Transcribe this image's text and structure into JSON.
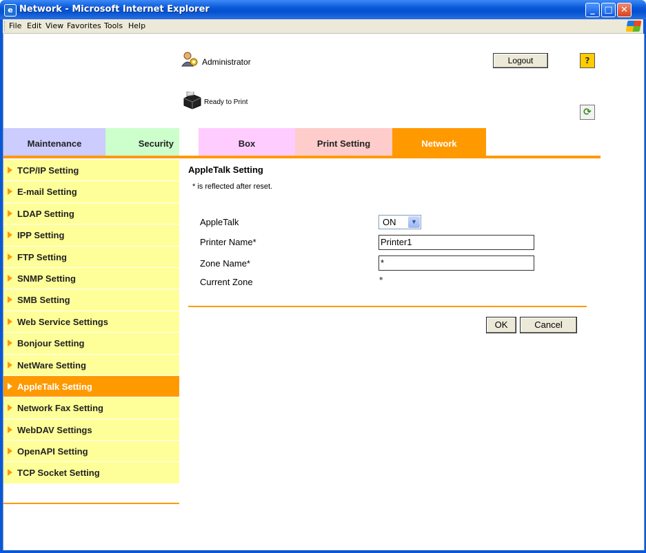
{
  "window": {
    "title": "Network - Microsoft Internet Explorer",
    "min": "_",
    "max": "□",
    "close": "✕"
  },
  "menu": {
    "items": [
      "File",
      "Edit",
      "View",
      "Favorites",
      "Tools",
      "Help"
    ]
  },
  "header": {
    "user": "Administrator",
    "logout": "Logout",
    "help": "?",
    "status": "Ready to Print",
    "refresh": "⟳"
  },
  "tabs": [
    {
      "label": "Maintenance"
    },
    {
      "label": "Security"
    },
    {
      "label": "Box"
    },
    {
      "label": "Print Setting"
    },
    {
      "label": "Network",
      "active": true
    }
  ],
  "sidebar": {
    "items": [
      {
        "label": "TCP/IP Setting"
      },
      {
        "label": "E-mail Setting"
      },
      {
        "label": "LDAP Setting"
      },
      {
        "label": "IPP Setting"
      },
      {
        "label": "FTP Setting"
      },
      {
        "label": "SNMP Setting"
      },
      {
        "label": "SMB Setting"
      },
      {
        "label": "Web Service Settings"
      },
      {
        "label": "Bonjour Setting"
      },
      {
        "label": "NetWare Setting"
      },
      {
        "label": "AppleTalk Setting",
        "active": true
      },
      {
        "label": "Network Fax Setting"
      },
      {
        "label": "WebDAV Settings"
      },
      {
        "label": "OpenAPI Setting"
      },
      {
        "label": "TCP Socket Setting"
      }
    ]
  },
  "main": {
    "title": "AppleTalk Setting",
    "note": "* is reflected after reset.",
    "fields": {
      "appletalk_label": "AppleTalk",
      "appletalk_value": "ON",
      "printer_name_label": "Printer Name*",
      "printer_name_value": "Printer1",
      "zone_name_label": "Zone Name*",
      "zone_name_value": "*",
      "current_zone_label": "Current Zone",
      "current_zone_value": "*"
    },
    "ok": "OK",
    "cancel": "Cancel"
  },
  "colors": {
    "accent": "#ff9900",
    "sidebar_bg": "#ffff99",
    "tab_maintenance": "#ccccff",
    "tab_security": "#ccffcc",
    "tab_box": "#ffccff",
    "tab_print": "#ffcccc"
  }
}
